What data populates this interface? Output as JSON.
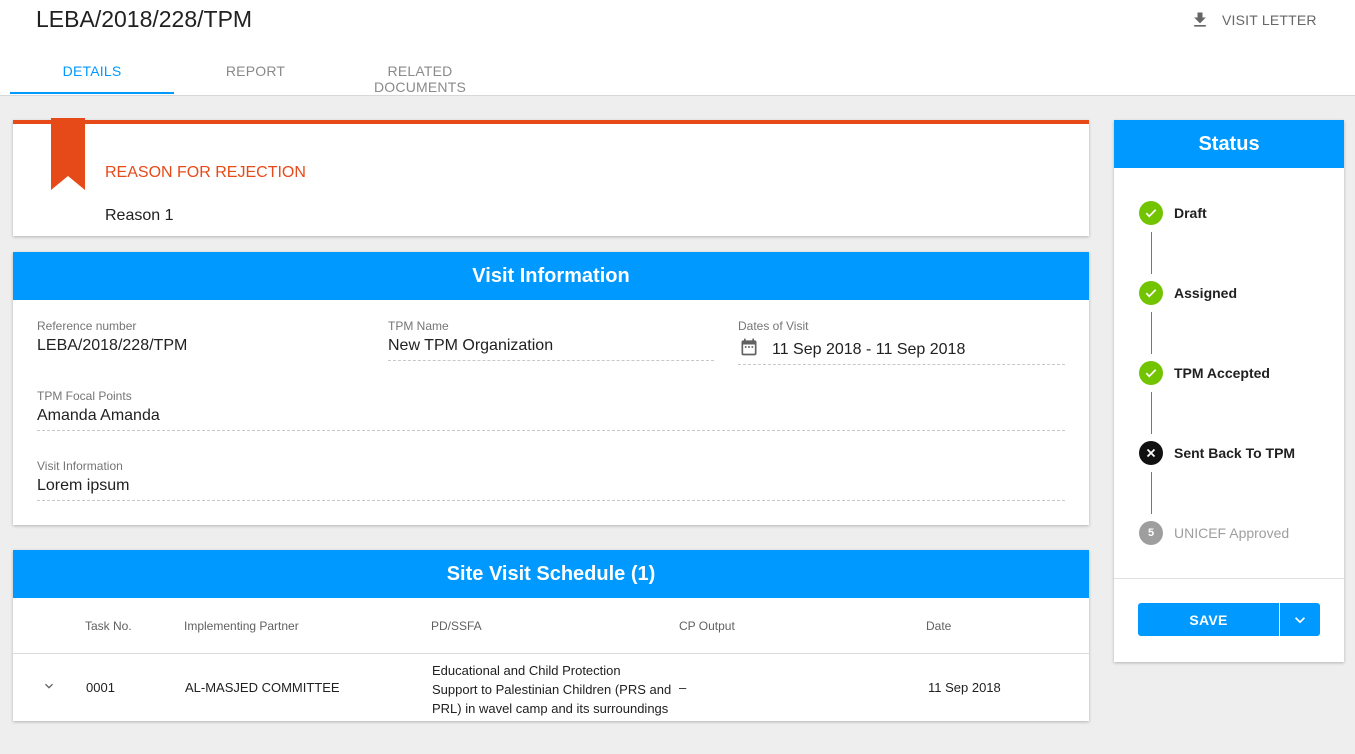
{
  "header": {
    "title": "LEBA/2018/228/TPM",
    "visit_letter_label": "VISIT LETTER",
    "tabs": [
      {
        "label": "DETAILS",
        "active": true
      },
      {
        "label": "REPORT",
        "active": false
      },
      {
        "label": "RELATED DOCUMENTS",
        "active": false
      }
    ]
  },
  "rejection": {
    "heading": "REASON FOR REJECTION",
    "reason": "Reason 1"
  },
  "visit_info": {
    "title": "Visit Information",
    "fields": {
      "reference": {
        "label": "Reference number",
        "value": "LEBA/2018/228/TPM"
      },
      "tpm_name": {
        "label": "TPM Name",
        "value": "New TPM Organization"
      },
      "dates": {
        "label": "Dates of Visit",
        "value": "11 Sep 2018 - 11 Sep 2018"
      },
      "focal_points": {
        "label": "TPM Focal Points",
        "value": "Amanda Amanda"
      },
      "visit_information": {
        "label": "Visit Information",
        "value": "Lorem ipsum"
      }
    }
  },
  "schedule": {
    "title": "Site Visit Schedule (1)",
    "columns": [
      "Task No.",
      "Implementing Partner",
      "PD/SSFA",
      "CP Output",
      "Date"
    ],
    "rows": [
      {
        "task_no": "0001",
        "partner": "AL-MASJED COMMITTEE",
        "pd_ssfa_lines": [
          "Educational and Child Protection",
          "Support to Palestinian Children (PRS and",
          "PRL) in wavel camp and its surroundings"
        ],
        "cp_output": "–",
        "date": "11 Sep 2018"
      }
    ]
  },
  "status": {
    "title": "Status",
    "steps": [
      {
        "label": "Draft",
        "state": "done",
        "icon": "check-icon"
      },
      {
        "label": "Assigned",
        "state": "done",
        "icon": "check-icon"
      },
      {
        "label": "TPM Accepted",
        "state": "done",
        "icon": "check-icon"
      },
      {
        "label": "Sent Back To TPM",
        "state": "rejected",
        "icon": "close-icon"
      },
      {
        "label": "UNICEF Approved",
        "state": "pending",
        "number": "5"
      }
    ],
    "save_label": "SAVE"
  },
  "colors": {
    "primary": "#0099ff",
    "rejection": "#e64a19",
    "done": "#72c300",
    "pending": "#9e9e9e"
  }
}
